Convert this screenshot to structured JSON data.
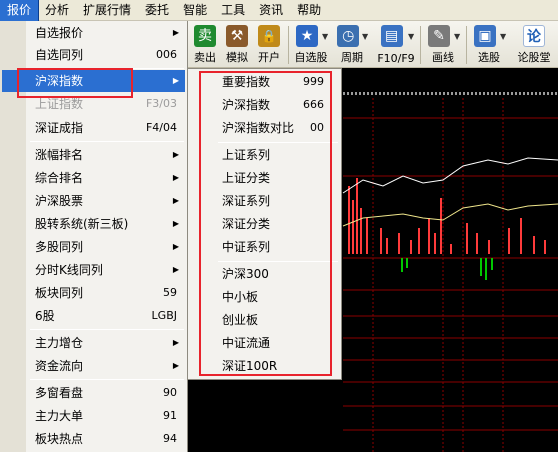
{
  "menubar": {
    "items": [
      {
        "label": "报价",
        "active": true
      },
      {
        "label": "分析"
      },
      {
        "label": "扩展行情"
      },
      {
        "label": "委托"
      },
      {
        "label": "智能"
      },
      {
        "label": "工具"
      },
      {
        "label": "资讯"
      },
      {
        "label": "帮助"
      }
    ]
  },
  "toolbar": {
    "buttons": [
      {
        "label": "卖出",
        "icon": "sell-icon",
        "glyph": "卖",
        "color": "#1f8a2f"
      },
      {
        "label": "模拟",
        "icon": "gavel-icon",
        "glyph": "⚒",
        "color": "#8a5a2b"
      },
      {
        "label": "开户",
        "icon": "lock-icon",
        "glyph": "🔒",
        "color": "#c08a1a"
      },
      {
        "label": "自选股",
        "icon": "star-folder-icon",
        "glyph": "★",
        "color": "#2d68c4"
      },
      {
        "label": "周期",
        "icon": "clock-icon",
        "glyph": "◷",
        "color": "#3b6fb0"
      },
      {
        "label": "F10/F9",
        "icon": "document-icon",
        "glyph": "▤",
        "color": "#3a72c2"
      },
      {
        "label": "画线",
        "icon": "pencil-icon",
        "glyph": "✎",
        "color": "#7a7a7a"
      },
      {
        "label": "选股",
        "icon": "screen-icon",
        "glyph": "▣",
        "color": "#3a72c2"
      },
      {
        "label": "论股堂",
        "icon": "discussion-icon",
        "glyph": "论",
        "color": "#1f5fb5"
      }
    ]
  },
  "main_menu": {
    "items": [
      {
        "label": "自选报价",
        "arrow": "▶"
      },
      {
        "label": "自选同列",
        "shortcut": "006"
      },
      {
        "label": "沪深指数",
        "arrow": "▶",
        "highlighted": true
      },
      {
        "label": "上证指数",
        "shortcut": "F3/03",
        "disabled": true
      },
      {
        "label": "深证成指",
        "shortcut": "F4/04"
      },
      {
        "label": "涨幅排名",
        "arrow": "▶"
      },
      {
        "label": "综合排名",
        "arrow": "▶"
      },
      {
        "label": "沪深股票",
        "arrow": "▶"
      },
      {
        "label": "股转系统(新三板)",
        "arrow": "▶"
      },
      {
        "label": "多股同列",
        "arrow": "▶"
      },
      {
        "label": "分时K线同列",
        "arrow": "▶"
      },
      {
        "label": "板块同列",
        "shortcut": "59"
      },
      {
        "label": "6股",
        "shortcut": "LGBJ"
      },
      {
        "label": "主力增仓",
        "arrow": "▶"
      },
      {
        "label": "资金流向",
        "arrow": "▶"
      },
      {
        "label": "多窗看盘",
        "shortcut": "90"
      },
      {
        "label": "主力大单",
        "shortcut": "91"
      },
      {
        "label": "板块热点",
        "shortcut": "94"
      }
    ]
  },
  "sub_menu": {
    "items": [
      {
        "label": "重要指数",
        "shortcut": "999"
      },
      {
        "label": "沪深指数",
        "shortcut": "666"
      },
      {
        "label": "沪深指数对比",
        "shortcut": "00"
      },
      {
        "label": "上证系列"
      },
      {
        "label": "上证分类"
      },
      {
        "label": "深证系列"
      },
      {
        "label": "深证分类"
      },
      {
        "label": "中证系列"
      },
      {
        "label": "沪深300"
      },
      {
        "label": "中小板"
      },
      {
        "label": "创业板"
      },
      {
        "label": "中证流通"
      },
      {
        "label": "深证100R"
      }
    ]
  },
  "colors": {
    "highlight": "#2b6fd1",
    "annotation_box": "#e8232c",
    "chart_bg": "#000000",
    "grid": "#8b0000",
    "line_white": "#ffffff",
    "line_yellow": "#f0e68c",
    "bar_up": "#ff3b3b",
    "bar_down": "#00c800"
  }
}
